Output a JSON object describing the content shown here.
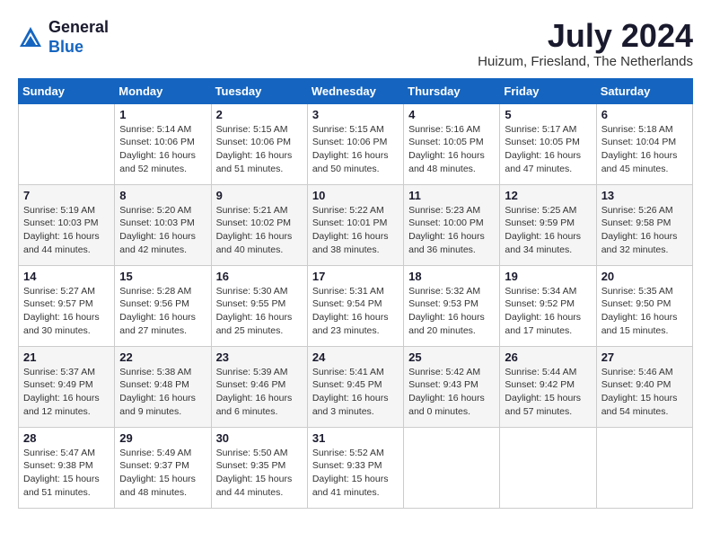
{
  "header": {
    "logo_general": "General",
    "logo_blue": "Blue",
    "month_year": "July 2024",
    "location": "Huizum, Friesland, The Netherlands"
  },
  "days_of_week": [
    "Sunday",
    "Monday",
    "Tuesday",
    "Wednesday",
    "Thursday",
    "Friday",
    "Saturday"
  ],
  "weeks": [
    [
      {
        "day": "",
        "info": ""
      },
      {
        "day": "1",
        "info": "Sunrise: 5:14 AM\nSunset: 10:06 PM\nDaylight: 16 hours\nand 52 minutes."
      },
      {
        "day": "2",
        "info": "Sunrise: 5:15 AM\nSunset: 10:06 PM\nDaylight: 16 hours\nand 51 minutes."
      },
      {
        "day": "3",
        "info": "Sunrise: 5:15 AM\nSunset: 10:06 PM\nDaylight: 16 hours\nand 50 minutes."
      },
      {
        "day": "4",
        "info": "Sunrise: 5:16 AM\nSunset: 10:05 PM\nDaylight: 16 hours\nand 48 minutes."
      },
      {
        "day": "5",
        "info": "Sunrise: 5:17 AM\nSunset: 10:05 PM\nDaylight: 16 hours\nand 47 minutes."
      },
      {
        "day": "6",
        "info": "Sunrise: 5:18 AM\nSunset: 10:04 PM\nDaylight: 16 hours\nand 45 minutes."
      }
    ],
    [
      {
        "day": "7",
        "info": "Sunrise: 5:19 AM\nSunset: 10:03 PM\nDaylight: 16 hours\nand 44 minutes."
      },
      {
        "day": "8",
        "info": "Sunrise: 5:20 AM\nSunset: 10:03 PM\nDaylight: 16 hours\nand 42 minutes."
      },
      {
        "day": "9",
        "info": "Sunrise: 5:21 AM\nSunset: 10:02 PM\nDaylight: 16 hours\nand 40 minutes."
      },
      {
        "day": "10",
        "info": "Sunrise: 5:22 AM\nSunset: 10:01 PM\nDaylight: 16 hours\nand 38 minutes."
      },
      {
        "day": "11",
        "info": "Sunrise: 5:23 AM\nSunset: 10:00 PM\nDaylight: 16 hours\nand 36 minutes."
      },
      {
        "day": "12",
        "info": "Sunrise: 5:25 AM\nSunset: 9:59 PM\nDaylight: 16 hours\nand 34 minutes."
      },
      {
        "day": "13",
        "info": "Sunrise: 5:26 AM\nSunset: 9:58 PM\nDaylight: 16 hours\nand 32 minutes."
      }
    ],
    [
      {
        "day": "14",
        "info": "Sunrise: 5:27 AM\nSunset: 9:57 PM\nDaylight: 16 hours\nand 30 minutes."
      },
      {
        "day": "15",
        "info": "Sunrise: 5:28 AM\nSunset: 9:56 PM\nDaylight: 16 hours\nand 27 minutes."
      },
      {
        "day": "16",
        "info": "Sunrise: 5:30 AM\nSunset: 9:55 PM\nDaylight: 16 hours\nand 25 minutes."
      },
      {
        "day": "17",
        "info": "Sunrise: 5:31 AM\nSunset: 9:54 PM\nDaylight: 16 hours\nand 23 minutes."
      },
      {
        "day": "18",
        "info": "Sunrise: 5:32 AM\nSunset: 9:53 PM\nDaylight: 16 hours\nand 20 minutes."
      },
      {
        "day": "19",
        "info": "Sunrise: 5:34 AM\nSunset: 9:52 PM\nDaylight: 16 hours\nand 17 minutes."
      },
      {
        "day": "20",
        "info": "Sunrise: 5:35 AM\nSunset: 9:50 PM\nDaylight: 16 hours\nand 15 minutes."
      }
    ],
    [
      {
        "day": "21",
        "info": "Sunrise: 5:37 AM\nSunset: 9:49 PM\nDaylight: 16 hours\nand 12 minutes."
      },
      {
        "day": "22",
        "info": "Sunrise: 5:38 AM\nSunset: 9:48 PM\nDaylight: 16 hours\nand 9 minutes."
      },
      {
        "day": "23",
        "info": "Sunrise: 5:39 AM\nSunset: 9:46 PM\nDaylight: 16 hours\nand 6 minutes."
      },
      {
        "day": "24",
        "info": "Sunrise: 5:41 AM\nSunset: 9:45 PM\nDaylight: 16 hours\nand 3 minutes."
      },
      {
        "day": "25",
        "info": "Sunrise: 5:42 AM\nSunset: 9:43 PM\nDaylight: 16 hours\nand 0 minutes."
      },
      {
        "day": "26",
        "info": "Sunrise: 5:44 AM\nSunset: 9:42 PM\nDaylight: 15 hours\nand 57 minutes."
      },
      {
        "day": "27",
        "info": "Sunrise: 5:46 AM\nSunset: 9:40 PM\nDaylight: 15 hours\nand 54 minutes."
      }
    ],
    [
      {
        "day": "28",
        "info": "Sunrise: 5:47 AM\nSunset: 9:38 PM\nDaylight: 15 hours\nand 51 minutes."
      },
      {
        "day": "29",
        "info": "Sunrise: 5:49 AM\nSunset: 9:37 PM\nDaylight: 15 hours\nand 48 minutes."
      },
      {
        "day": "30",
        "info": "Sunrise: 5:50 AM\nSunset: 9:35 PM\nDaylight: 15 hours\nand 44 minutes."
      },
      {
        "day": "31",
        "info": "Sunrise: 5:52 AM\nSunset: 9:33 PM\nDaylight: 15 hours\nand 41 minutes."
      },
      {
        "day": "",
        "info": ""
      },
      {
        "day": "",
        "info": ""
      },
      {
        "day": "",
        "info": ""
      }
    ]
  ]
}
